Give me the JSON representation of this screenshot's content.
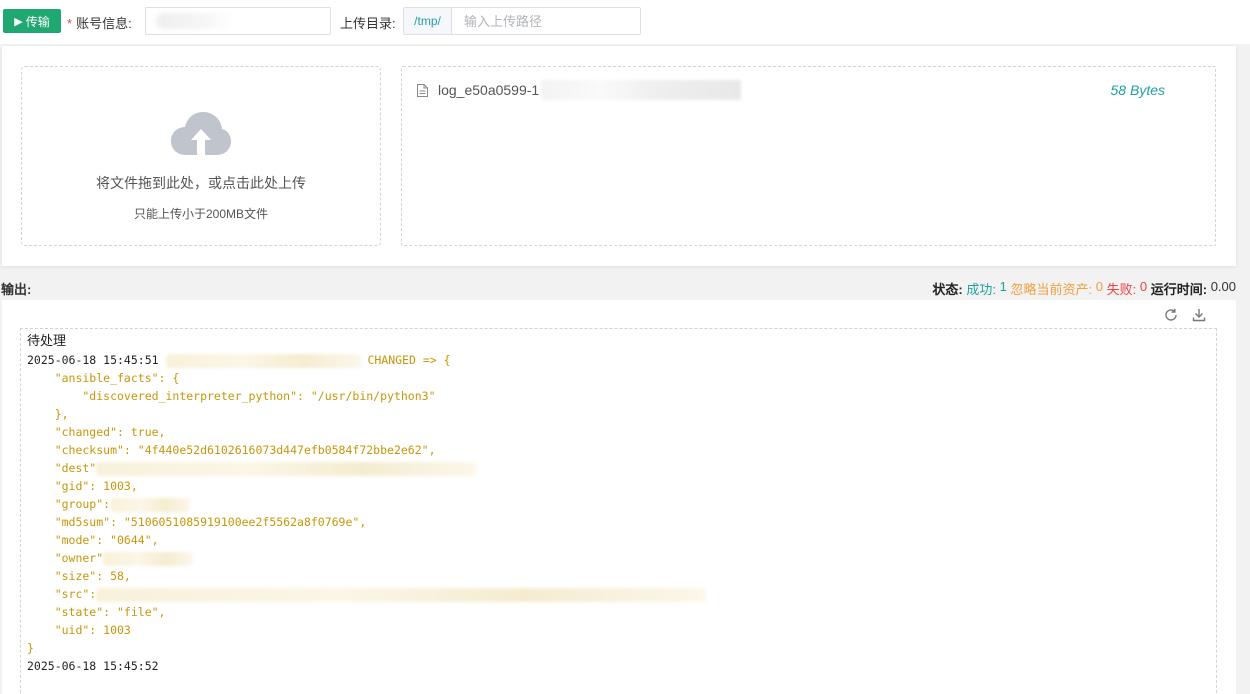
{
  "toolbar": {
    "run_label": "传输",
    "account_required": "*",
    "account_label": "账号信息:",
    "path_label": "上传目录:",
    "path_prefix": "/tmp/",
    "path_placeholder": "输入上传路径"
  },
  "upload": {
    "drop_text": "将文件拖到此处，或点击此处上传",
    "drop_tip": "只能上传小于200MB文件",
    "files": [
      {
        "name": "log_e50a0599-1",
        "size": "58 Bytes"
      }
    ]
  },
  "output": {
    "label": "输出:",
    "status_label": "状态:",
    "success_label": "成功:",
    "success_count": "1",
    "skip_label": "忽略当前资产:",
    "skip_count": "0",
    "fail_label": "失败:",
    "fail_count": "0",
    "runtime_label": "运行时间:",
    "runtime_value": "0.00"
  },
  "console": {
    "pending": "待处理",
    "ts1": "2025-06-18 15:45:51",
    "changed": "CHANGED => {",
    "l_ansible_facts": "    \"ansible_facts\": {",
    "l_interp": "        \"discovered_interpreter_python\": \"/usr/bin/python3\"",
    "l_close_facts": "    },",
    "l_changed": "    \"changed\": true,",
    "l_checksum": "    \"checksum\": \"4f440e52d6102616073d447efb0584f72bbe2e62\",",
    "l_dest": "    \"dest\"",
    "l_gid": "    \"gid\": 1003,",
    "l_group": "    \"group\":",
    "l_md5": "    \"md5sum\": \"5106051085919100ee2f5562a8f0769e\",",
    "l_mode": "    \"mode\": \"0644\",",
    "l_owner": "    \"owner\"",
    "l_size": "    \"size\": 58,",
    "l_src": "    \"src\":",
    "l_state": "    \"state\": \"file\",",
    "l_uid": "    \"uid\": 1003",
    "l_close": "}",
    "ts2": "2025-06-18 15:45:52"
  },
  "icons": {
    "run": "play-icon",
    "cloud": "cloud-upload-icon",
    "file": "document-icon",
    "refresh": "refresh-icon",
    "download": "download-icon"
  },
  "colors": {
    "accent": "#20a873",
    "teal": "#20a0a0",
    "warning": "#f0a040",
    "danger": "#e54545",
    "console_gold": "#c8960a"
  }
}
